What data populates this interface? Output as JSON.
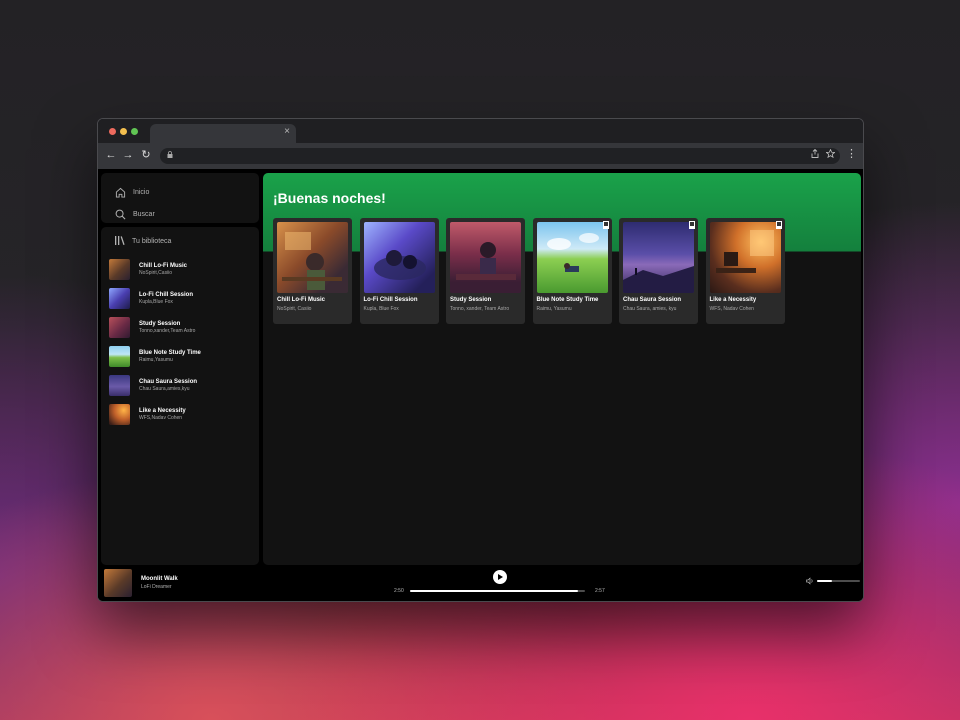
{
  "browser": {
    "tab_title": "",
    "url": "",
    "close_glyph": "×",
    "back_glyph": "←",
    "forward_glyph": "→",
    "reload_glyph": "↻",
    "menu_glyph": "⋮"
  },
  "nav": {
    "home_label": "Inicio",
    "search_label": "Buscar"
  },
  "library": {
    "title": "Tu biblioteca",
    "items": [
      {
        "title": "Chill Lo-Fi Music",
        "subtitle": "NoSpirit,Casiio"
      },
      {
        "title": "Lo-Fi Chill Session",
        "subtitle": "Kupla,Blue Fox"
      },
      {
        "title": "Study Session",
        "subtitle": "Tonno,xander,Team Astro"
      },
      {
        "title": "Blue Note Study Time",
        "subtitle": "Raimu,Yasumu"
      },
      {
        "title": "Chau Saura Session",
        "subtitle": "Chau Saura,amies,kyu"
      },
      {
        "title": "Like a Necessity",
        "subtitle": "WFS,Nadav Cohen"
      }
    ]
  },
  "main": {
    "greeting": "¡Buenas noches!",
    "cards": [
      {
        "title": "Chill Lo-Fi Music",
        "subtitle": "NoSpirit, Casiio"
      },
      {
        "title": "Lo-Fi Chill Session",
        "subtitle": "Kupla, Blue Fox"
      },
      {
        "title": "Study Session",
        "subtitle": "Tonno, xander, Team Astro"
      },
      {
        "title": "Blue Note Study Time",
        "subtitle": "Raimu, Yasumu"
      },
      {
        "title": "Chau Saura Session",
        "subtitle": "Chau Saura, amies, kyu"
      },
      {
        "title": "Like a Necessity",
        "subtitle": "WFS, Nadav Cohen"
      }
    ]
  },
  "player": {
    "track_title": "Moonlit Walk",
    "artist": "LoFi Dreamer",
    "current_time": "2:50",
    "total_time": "2:57",
    "progress_fraction": 0.96,
    "volume_fraction": 0.35
  },
  "colors": {
    "accent_green": "#1db954",
    "background": "#121212"
  }
}
